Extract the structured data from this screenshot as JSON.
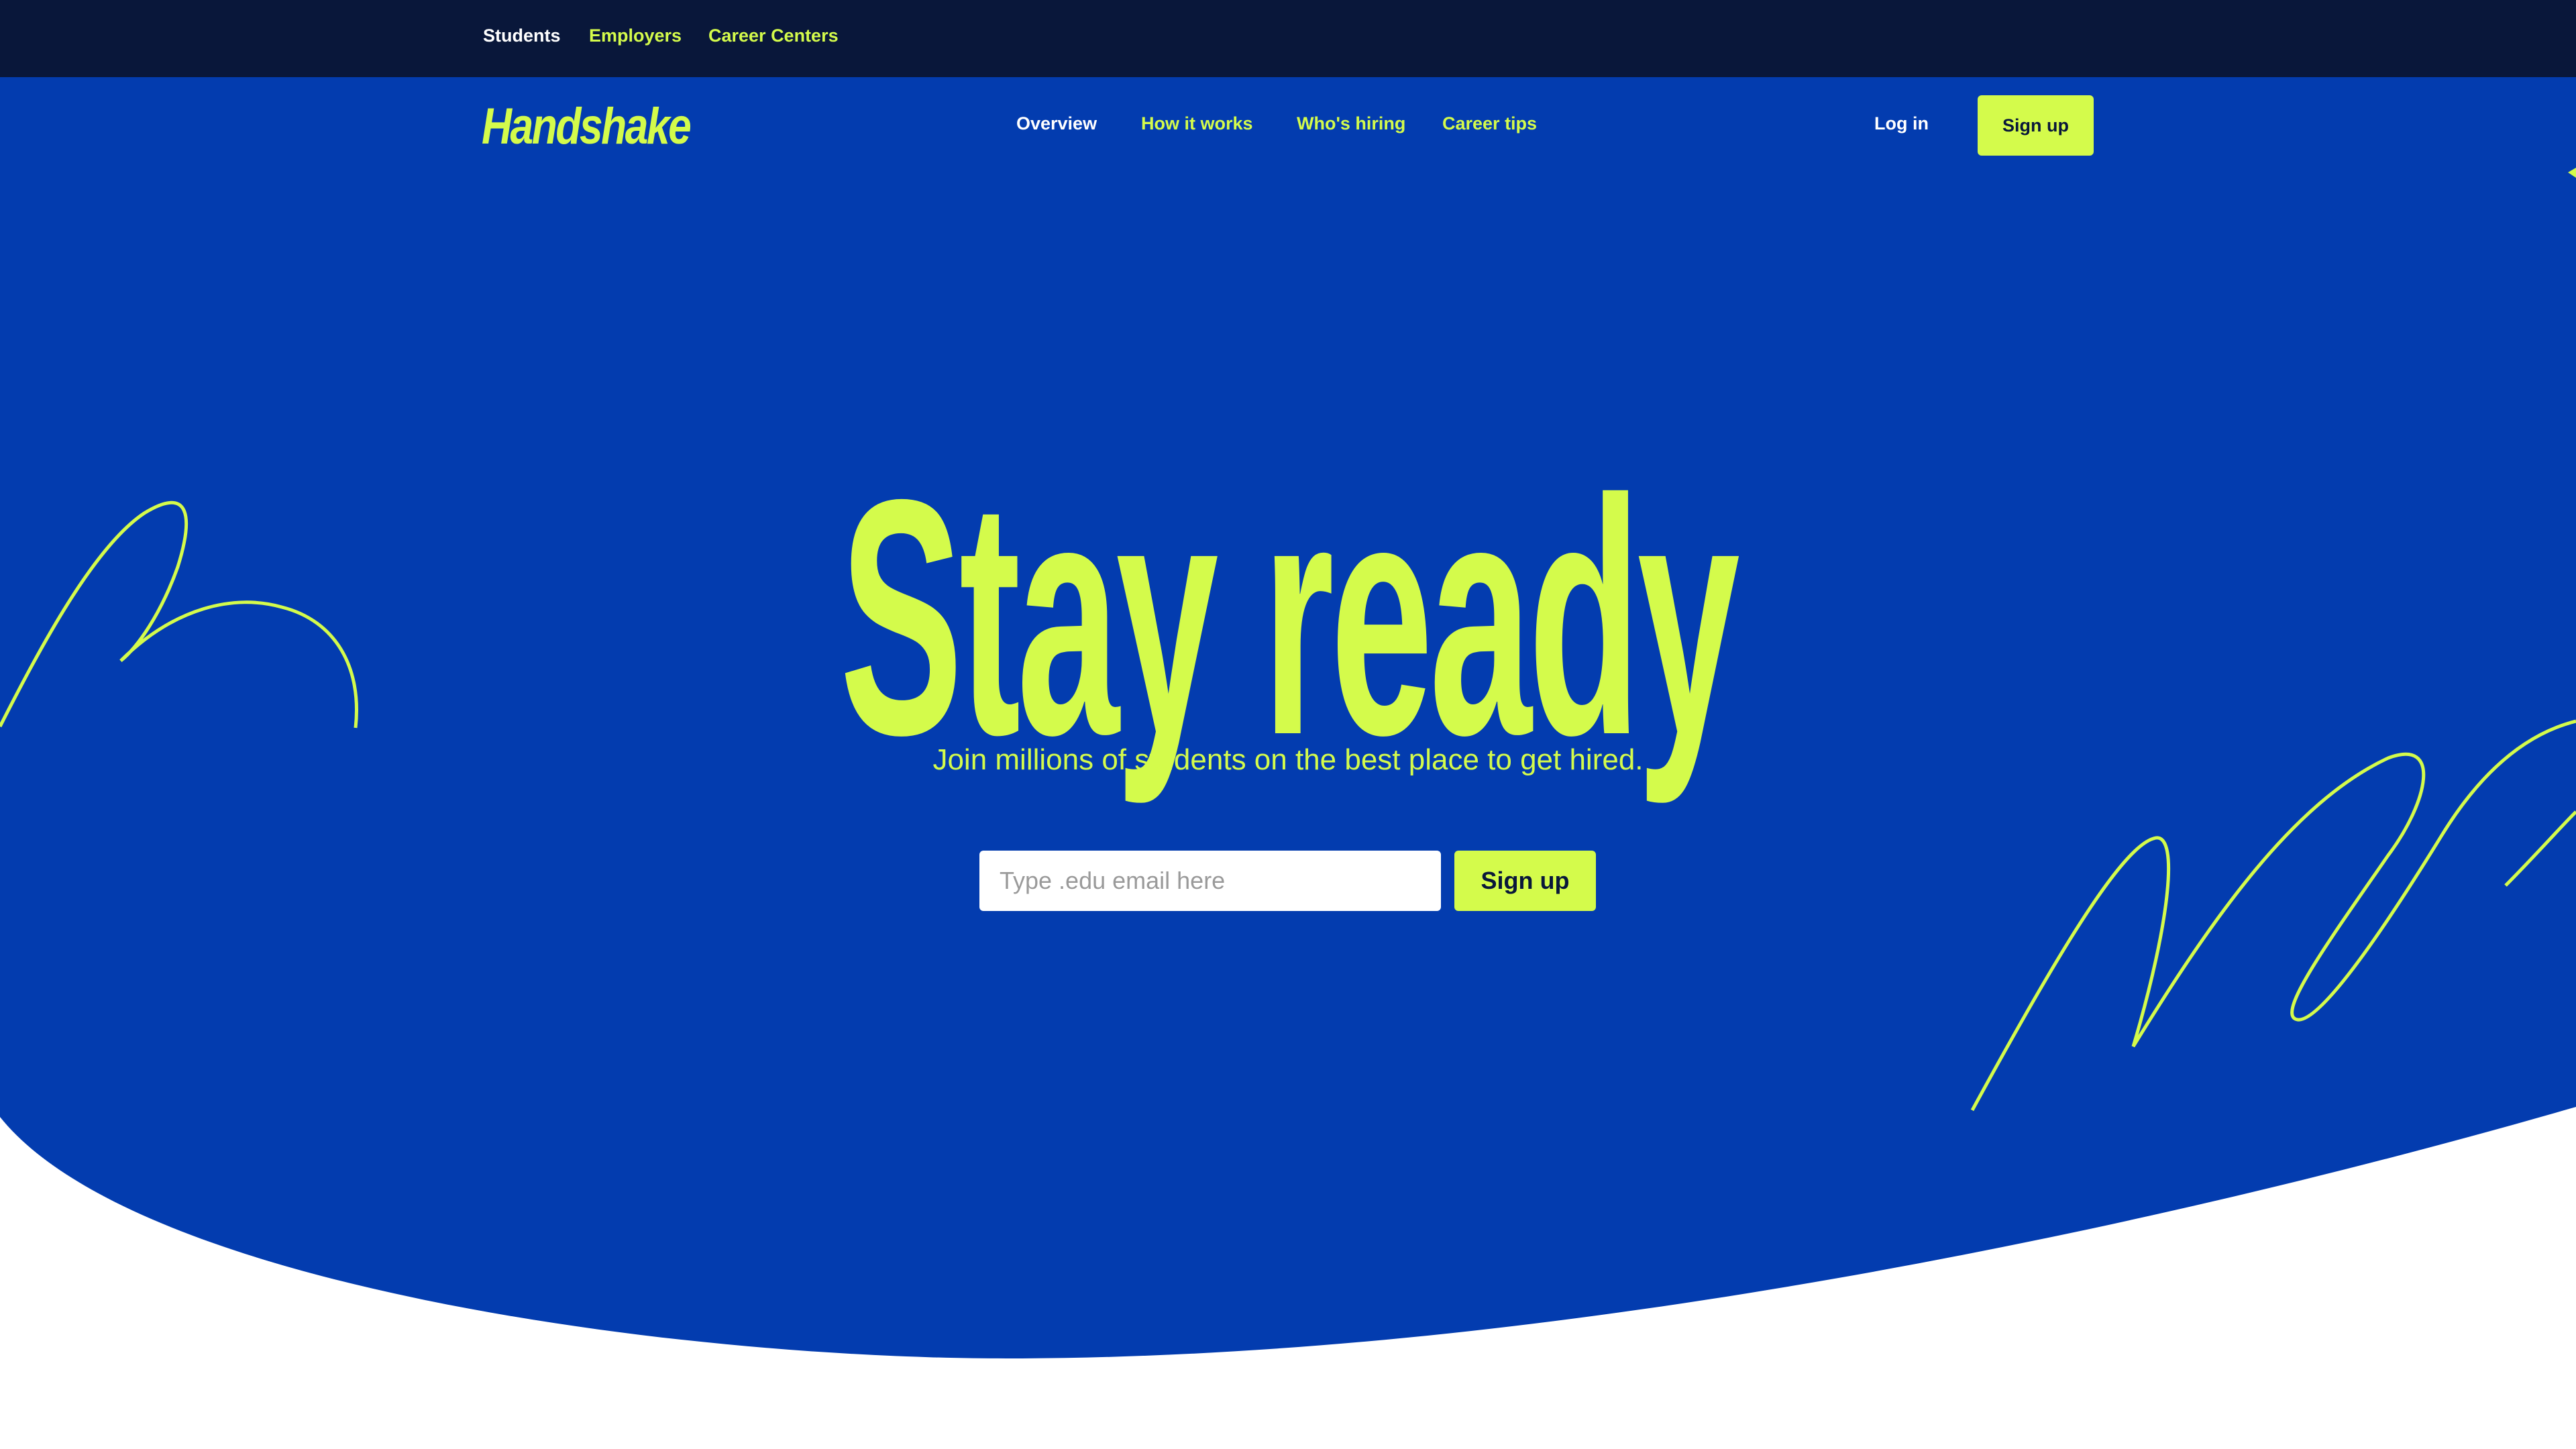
{
  "colors": {
    "topbar": "#09173a",
    "hero": "#033caf",
    "accent": "#d4fb4b",
    "white": "#ffffff"
  },
  "topbar": {
    "links": [
      {
        "label": "Students",
        "active": true
      },
      {
        "label": "Employers",
        "active": false
      },
      {
        "label": "Career Centers",
        "active": false
      }
    ]
  },
  "nav": {
    "logo": "Handshake",
    "links": [
      {
        "label": "Overview",
        "active": true
      },
      {
        "label": "How it works",
        "active": false
      },
      {
        "label": "Who's hiring",
        "active": false
      },
      {
        "label": "Career tips",
        "active": false
      }
    ],
    "login": "Log in",
    "signup": "Sign up"
  },
  "hero": {
    "headline": "Stay ready",
    "subtitle": "Join millions of students on the best place to get hired.",
    "email_placeholder": "Type .edu email here",
    "signup": "Sign up"
  }
}
